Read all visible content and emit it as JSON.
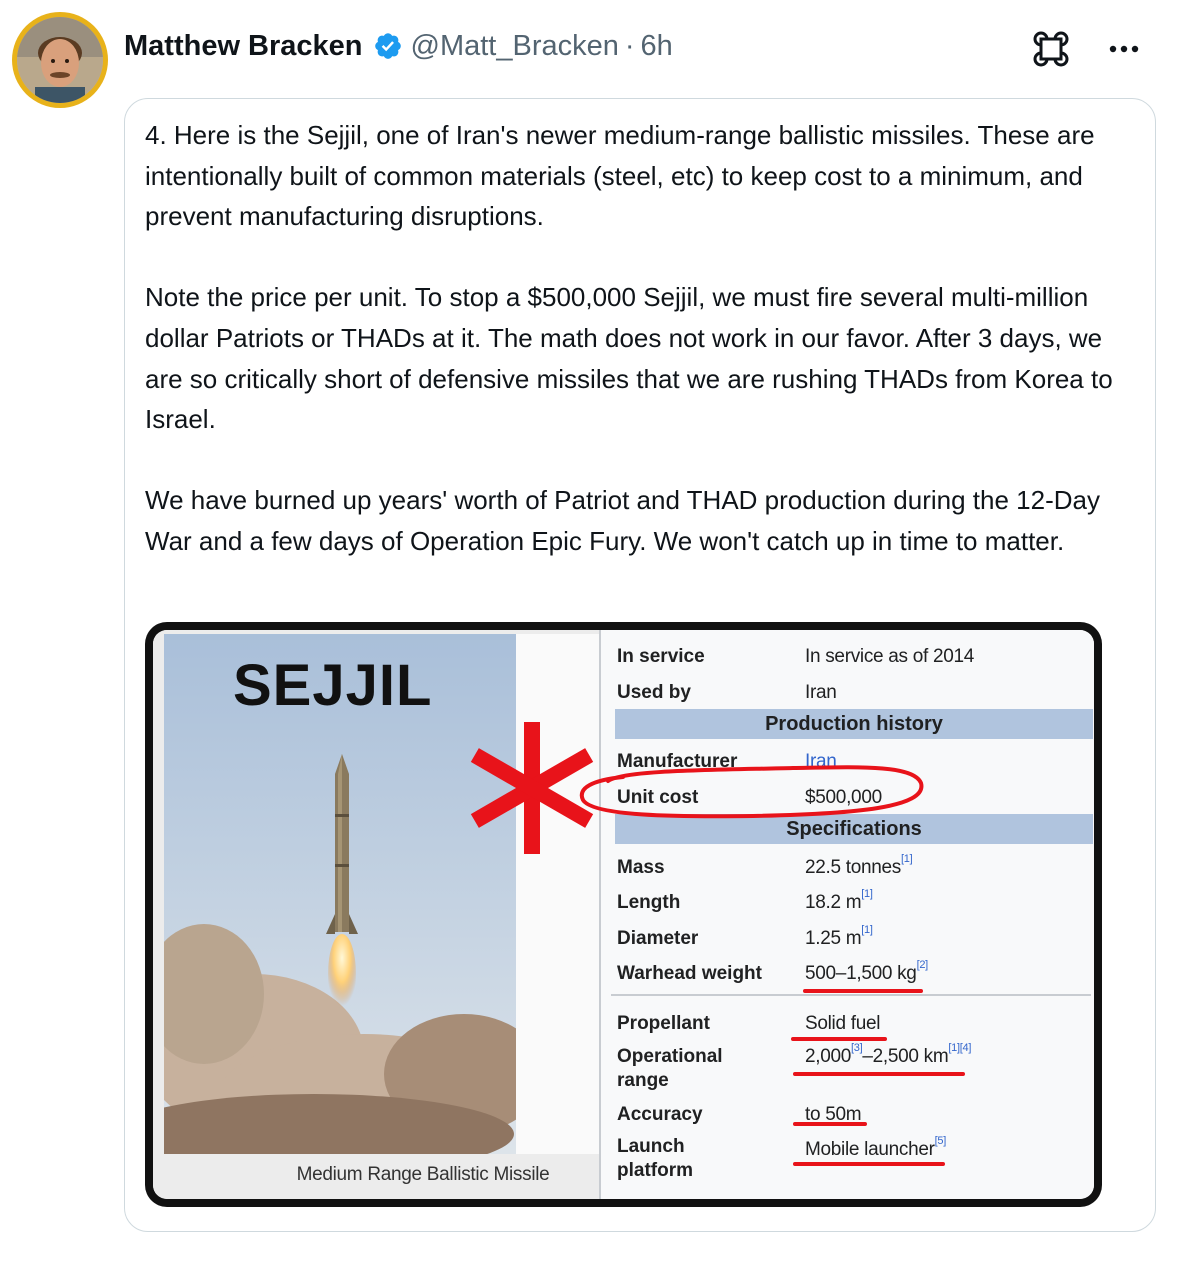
{
  "author": {
    "name": "Matthew Bracken",
    "handle": "@Matt_Bracken",
    "separator": "·",
    "time": "6h"
  },
  "icons": {
    "verified": "verified-badge-icon",
    "command": "command-icon",
    "more": "more-options-icon"
  },
  "colors": {
    "verified_blue": "#1d9bf0",
    "avatar_ring": "#e8b21a",
    "annotation_red": "#e8131a",
    "section_band": "#b0c4de",
    "link_blue": "#3366cc"
  },
  "tweet": {
    "text": "4. Here is the Sejjil, one of Iran's newer medium-range ballistic missiles. These are intentionally built of common materials (steel, etc) to keep cost to a minimum, and prevent manufacturing disruptions.\n\nNote the price per unit. To stop a $500,000 Sejjil, we must fire several multi-million dollar Patriots or THADs at it. The math does not work in our favor. After 3 days, we are so critically short of defensive missiles that we are rushing THADs from Korea to Israel.\n\nWe have burned up years' worth of Patriot and THAD production during the 12-Day War and a few days of Operation Epic Fury. We won't catch up in time to matter."
  },
  "media": {
    "title": "SEJJIL",
    "caption": "Medium Range Ballistic Missile",
    "infobox": {
      "rows_top": [
        {
          "label": "In service",
          "value": "In service as of 2014"
        },
        {
          "label": "Used by",
          "value": "Iran"
        }
      ],
      "production_header": "Production history",
      "manufacturer_label": "Manufacturer",
      "manufacturer_value": "Iran",
      "unit_cost_label": "Unit cost",
      "unit_cost_value": "$500,000",
      "specifications_header": "Specifications",
      "mass_label": "Mass",
      "mass_value": "22.5 tonnes",
      "mass_ref": "[1]",
      "length_label": "Length",
      "length_value": "18.2 m",
      "length_ref": "[1]",
      "diameter_label": "Diameter",
      "diameter_value": "1.25 m",
      "diameter_ref": "[1]",
      "warhead_label": "Warhead weight",
      "warhead_value": "500–1,500 kg",
      "warhead_ref": "[2]",
      "propellant_label": "Propellant",
      "propellant_value": "Solid fuel",
      "range_label_1": "Operational",
      "range_label_2": "range",
      "range_value_a": "2,000",
      "range_ref_a": "[3]",
      "range_value_b": "–2,500 km",
      "range_ref_b": "[1][4]",
      "accuracy_label": "Accuracy",
      "accuracy_value": "to 50m",
      "launch_label_1": "Launch",
      "launch_label_2": "platform",
      "launch_value": "Mobile launcher",
      "launch_ref": "[5]"
    }
  }
}
